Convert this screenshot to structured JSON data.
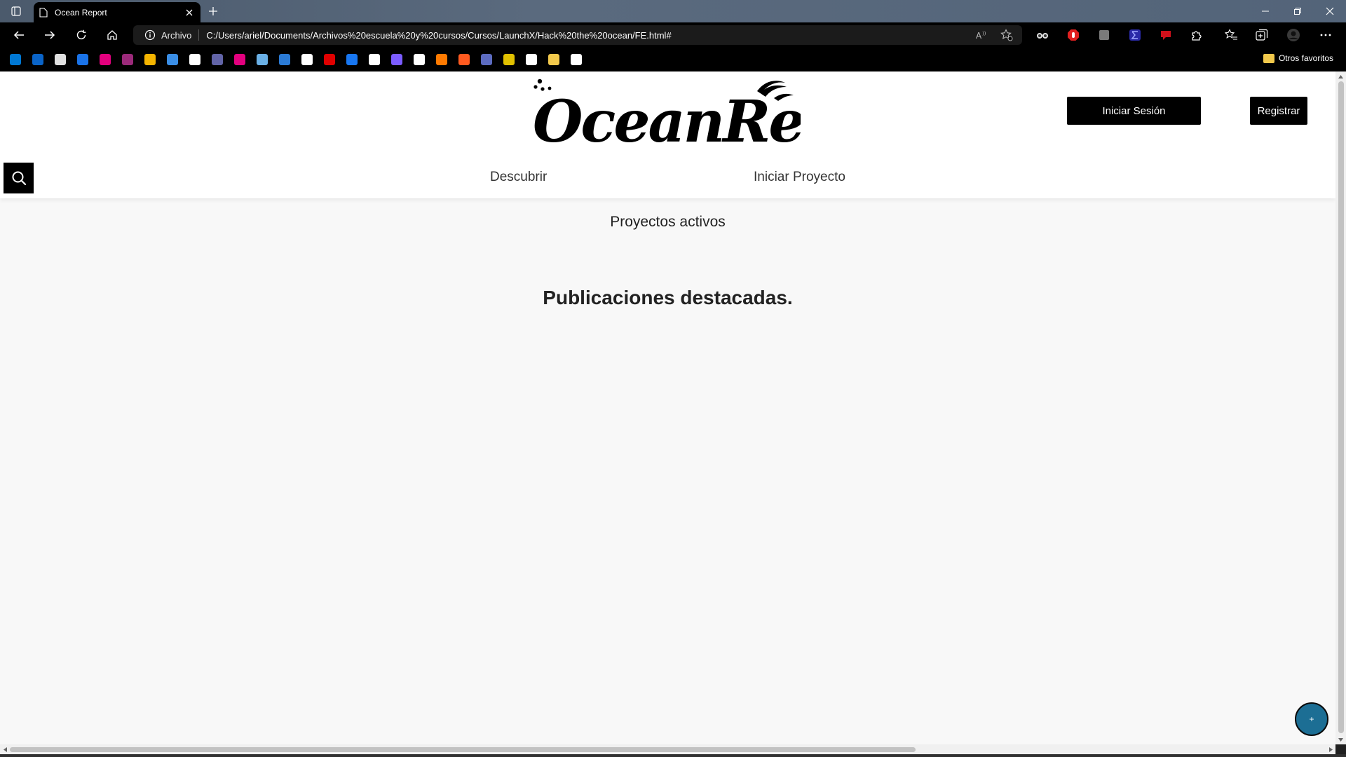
{
  "browser": {
    "tab_title": "Ocean Report",
    "protocol_label": "Archivo",
    "url": "C:/Users/ariel/Documents/Archivos%20escuela%20y%20cursos/Cursos/LaunchX/Hack%20the%20ocean/FE.html#",
    "other_favorites": "Otros favoritos",
    "bookmark_colors": [
      "#0078d4",
      "#0a64c8",
      "#e0e0e0",
      "#1a73e8",
      "#e3007e",
      "#9b2a7a",
      "#f4b400",
      "#3a8ee6",
      "#ffffff",
      "#6264a7",
      "#e3007e",
      "#6ab0e6",
      "#2b7bd6",
      "#ffffff",
      "#e00000",
      "#1877f2",
      "#ffffff",
      "#7b5cff",
      "#ffffff",
      "#ff7a00",
      "#ff5a1f",
      "#5c6bc0",
      "#e0c000",
      "#ffffff",
      "#f2c94c",
      "#ffffff"
    ]
  },
  "page": {
    "logo_text": "OceanReport",
    "login_label": "Iniciar Sesión",
    "register_label": "Registrar",
    "nav": {
      "discover": "Descubrir",
      "start_project": "Iniciar Proyecto"
    },
    "active_projects_title": "Proyectos activos",
    "featured_title": "Publicaciones destacadas.",
    "fab_label": "+"
  }
}
